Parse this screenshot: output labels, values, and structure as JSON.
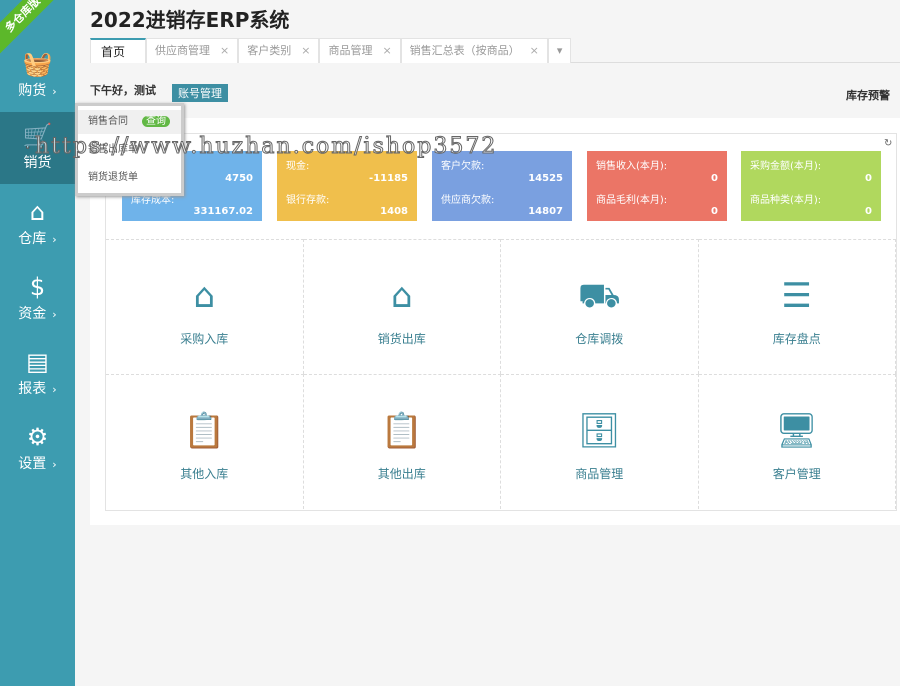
{
  "brand_ribbon": "多仓库版",
  "title": "2022进销存ERP系统",
  "sidebar": [
    {
      "label": "购货",
      "icon": "basket-icon"
    },
    {
      "label": "销货",
      "icon": "cart-icon"
    },
    {
      "label": "仓库",
      "icon": "warehouse-icon"
    },
    {
      "label": "资金",
      "icon": "dollar-icon"
    },
    {
      "label": "报表",
      "icon": "report-icon"
    },
    {
      "label": "设置",
      "icon": "gear-icon"
    }
  ],
  "tabs": [
    {
      "label": "首页"
    },
    {
      "label": "供应商管理"
    },
    {
      "label": "客户类别"
    },
    {
      "label": "商品管理"
    },
    {
      "label": "销售汇总表（按商品）"
    }
  ],
  "welcome": "下午好，测试",
  "account_button": "账号管理",
  "stock_alert": "库存预警",
  "popup": {
    "items": [
      {
        "label": "销售合同",
        "badge": "查询"
      },
      {
        "label": "销售出库单"
      },
      {
        "label": "销货退货单"
      }
    ]
  },
  "cards": [
    {
      "color": "#6fb3ea",
      "label1": "",
      "value1": "4750",
      "label2": "库存成本:",
      "value2": "331167.02"
    },
    {
      "color": "#f0bf4c",
      "label1": "现金:",
      "value1": "-11185",
      "label2": "银行存款:",
      "value2": "1408"
    },
    {
      "color": "#7aa0e0",
      "label1": "客户欠款:",
      "value1": "14525",
      "label2": "供应商欠款:",
      "value2": "14807"
    },
    {
      "color": "#eb7566",
      "label1": "销售收入(本月):",
      "value1": "0",
      "label2": "商品毛利(本月):",
      "value2": "0"
    },
    {
      "color": "#b0d85e",
      "label1": "采购金额(本月):",
      "value1": "0",
      "label2": "商品种类(本月):",
      "value2": "0"
    }
  ],
  "shortcuts": [
    {
      "label": "采购入库"
    },
    {
      "label": "销货出库"
    },
    {
      "label": "仓库调拨"
    },
    {
      "label": "库存盘点"
    },
    {
      "label": "其他入库"
    },
    {
      "label": "其他出库"
    },
    {
      "label": "商品管理"
    },
    {
      "label": "客户管理"
    }
  ],
  "watermark": "https://www.huzhan.com/ishop3572"
}
